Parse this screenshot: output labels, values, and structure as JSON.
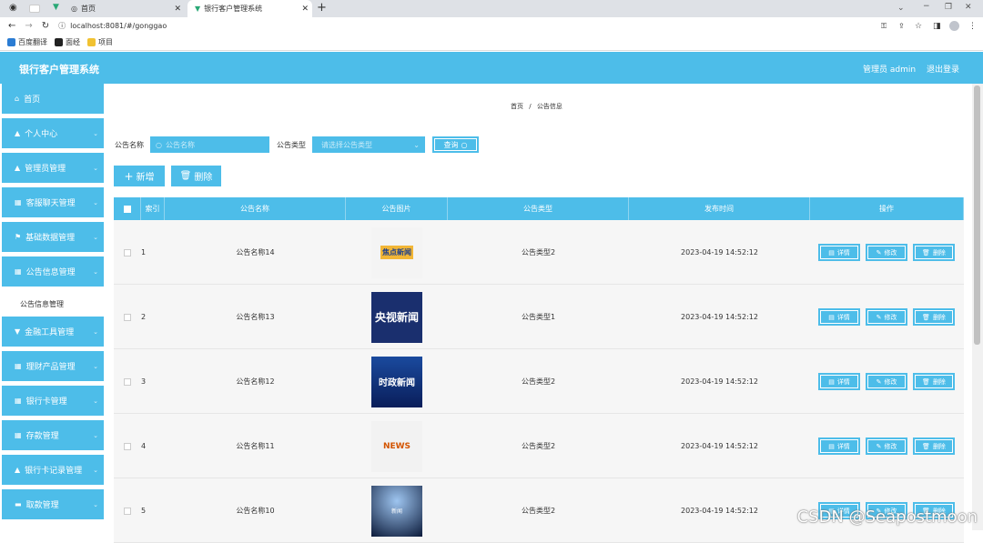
{
  "browser": {
    "tabs": [
      {
        "label": ""
      },
      {
        "label": "首页"
      },
      {
        "label": "银行客户管理系统"
      }
    ],
    "url": "localhost:8081/#/gonggao",
    "bookmarks": [
      {
        "label": "百度翻译",
        "color": "#2b7cd3"
      },
      {
        "label": "面经",
        "color": "#222"
      },
      {
        "label": "项目",
        "color": "#f1c232"
      }
    ]
  },
  "header": {
    "title": "银行客户管理系统",
    "user": "管理员 admin",
    "logout": "退出登录"
  },
  "sidebar": {
    "items": [
      {
        "label": "首页",
        "icon": "home-icon",
        "glyph": "⌂"
      },
      {
        "label": "个人中心",
        "icon": "user-icon",
        "glyph": "▲"
      },
      {
        "label": "管理员管理",
        "icon": "user-icon",
        "glyph": "▲"
      },
      {
        "label": "客服聊天管理",
        "icon": "grid-icon",
        "glyph": "▦"
      },
      {
        "label": "基础数据管理",
        "icon": "flag-icon",
        "glyph": "⚑"
      },
      {
        "label": "公告信息管理",
        "icon": "grid-icon",
        "glyph": "▦"
      },
      {
        "label": "金融工具管理",
        "icon": "filter-icon",
        "glyph": "▼"
      },
      {
        "label": "理财产品管理",
        "icon": "grid-icon",
        "glyph": "▦"
      },
      {
        "label": "银行卡管理",
        "icon": "grid-icon",
        "glyph": "▦"
      },
      {
        "label": "存款管理",
        "icon": "grid-icon",
        "glyph": "▦"
      },
      {
        "label": "银行卡记录管理",
        "icon": "user-icon",
        "glyph": "▲"
      },
      {
        "label": "取款管理",
        "icon": "monitor-icon",
        "glyph": "▬"
      }
    ],
    "sub_item": "公告信息管理"
  },
  "breadcrumb": {
    "home": "首页",
    "sep": "/",
    "current": "公告信息"
  },
  "search": {
    "name_label": "公告名称",
    "name_placeholder": "公告名称",
    "type_label": "公告类型",
    "type_placeholder": "请选择公告类型",
    "search_btn": "查询"
  },
  "actions": {
    "add": "新增",
    "delete": "删除"
  },
  "table": {
    "headers": [
      "",
      "索引",
      "公告名称",
      "公告图片",
      "公告类型",
      "发布时间",
      "操作"
    ],
    "ops": {
      "detail": "详情",
      "edit": "修改",
      "delete": "删除"
    },
    "rows": [
      {
        "index": "1",
        "name": "公告名称14",
        "image_text": "焦点新闻",
        "type": "公告类型2",
        "time": "2023-04-19 14:52:12"
      },
      {
        "index": "2",
        "name": "公告名称13",
        "image_text": "央视新闻",
        "type": "公告类型1",
        "time": "2023-04-19 14:52:12"
      },
      {
        "index": "3",
        "name": "公告名称12",
        "image_text": "时政新闻",
        "type": "公告类型2",
        "time": "2023-04-19 14:52:12"
      },
      {
        "index": "4",
        "name": "公告名称11",
        "image_text": "NEWS",
        "type": "公告类型2",
        "time": "2023-04-19 14:52:12"
      },
      {
        "index": "5",
        "name": "公告名称10",
        "image_text": "新闻",
        "type": "公告类型2",
        "time": "2023-04-19 14:52:12"
      }
    ]
  },
  "watermark": "CSDN @Seapostmoon"
}
